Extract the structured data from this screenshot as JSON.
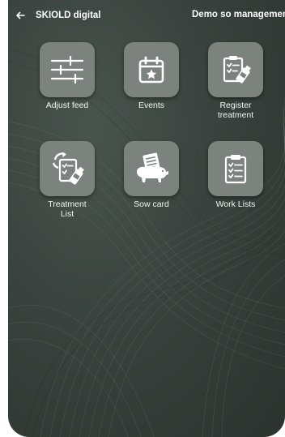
{
  "topbar": {
    "back_icon": "arrow-left-icon",
    "app_title": "SKIOLD digital",
    "user_title": "Demo so management"
  },
  "menu": [
    {
      "label": "Adjust feed",
      "icon": "sliders-icon"
    },
    {
      "label": "Events",
      "icon": "calendar-star-icon"
    },
    {
      "label": "Register\ntreatment",
      "icon": "clipboard-medicine-icon"
    },
    {
      "label": "Treatment\nList",
      "icon": "treatment-list-icon"
    },
    {
      "label": "Sow card",
      "icon": "sow-card-icon"
    },
    {
      "label": "Work Lists",
      "icon": "clipboard-list-icon"
    }
  ],
  "colors": {
    "background": "#39423e",
    "tile": "#7c837f",
    "text": "#ffffff"
  }
}
